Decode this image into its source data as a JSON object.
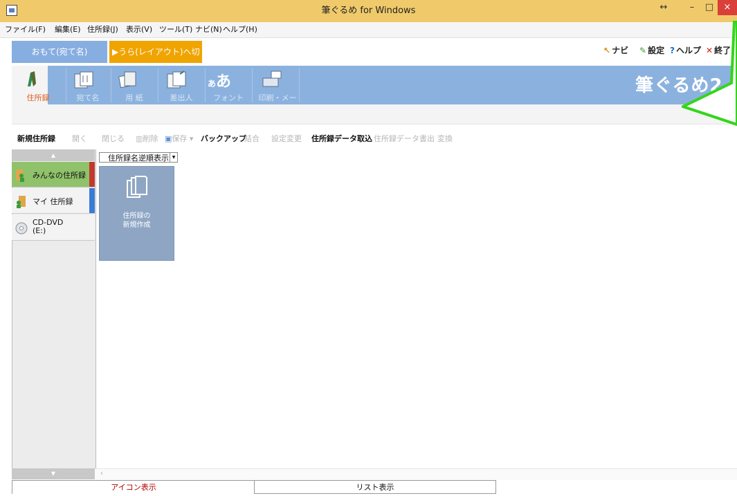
{
  "window": {
    "title": "筆ぐるめ for Windows",
    "restore_glyph": "↔",
    "minimize_glyph": "–",
    "maximize_glyph": "□",
    "close_glyph": "×"
  },
  "menu": [
    "ファイル(F)",
    "編集(E)",
    "住所録(J)",
    "表示(V)",
    "ツール(T)",
    "ナビ(N)",
    "ヘルプ(H)"
  ],
  "mode_tabs": {
    "front": "おもて(宛て名)",
    "back": "▶うら(レイアウト)へ切替"
  },
  "top_links": [
    {
      "icon": "navi-arrow-icon",
      "glyph": "↖",
      "color": "#e08a1a",
      "label": "ナビ"
    },
    {
      "icon": "wrench-icon",
      "glyph": "✎",
      "color": "#4a9a2a",
      "label": "設定"
    },
    {
      "icon": "help-icon",
      "glyph": "?",
      "color": "#1a6fd0",
      "label": "ヘルプ"
    },
    {
      "icon": "close-x-icon",
      "glyph": "✕",
      "color": "#d02020",
      "label": "終了"
    }
  ],
  "ribbon": {
    "items": [
      "住所録",
      "宛て名",
      "用 紙",
      "差出人",
      "フォント",
      "印刷・メール"
    ],
    "brand": "筆ぐるめ2"
  },
  "toolbar": [
    {
      "label": "新規住所録",
      "state": "bold"
    },
    {
      "label": "開く",
      "state": "dim"
    },
    {
      "label": "閉じる",
      "state": "dim"
    },
    {
      "label": "削除",
      "state": "dim"
    },
    {
      "label": "保存 ▾",
      "state": "dim"
    },
    {
      "label": "バックアップ",
      "state": "bold"
    },
    {
      "label": "結合",
      "state": "dim"
    },
    {
      "label": "設定変更",
      "state": "dim"
    },
    {
      "label": "住所録データ取込",
      "state": "bold"
    },
    {
      "label": "住所録データ書出",
      "state": "dim"
    },
    {
      "label": "変換",
      "state": "dim"
    }
  ],
  "address_books": [
    {
      "label": "みんなの住所録",
      "color": "#c0392b"
    },
    {
      "label": "マイ 住所録",
      "color": "#3a7bd5"
    },
    {
      "label": "CD-DVD\n(E:)",
      "color": ""
    }
  ],
  "sort_select": {
    "value": "住所録名逆順表示"
  },
  "new_card": {
    "line1": "住所録の",
    "line2": "新規作成"
  },
  "bottom_tabs": [
    "アイコン表示",
    "リスト表示"
  ],
  "colors": {
    "titlebar": "#f0ca6a",
    "ribbon": "#8bb2df",
    "accent_orange": "#f0a400",
    "green_arrow": "#33d61a"
  }
}
